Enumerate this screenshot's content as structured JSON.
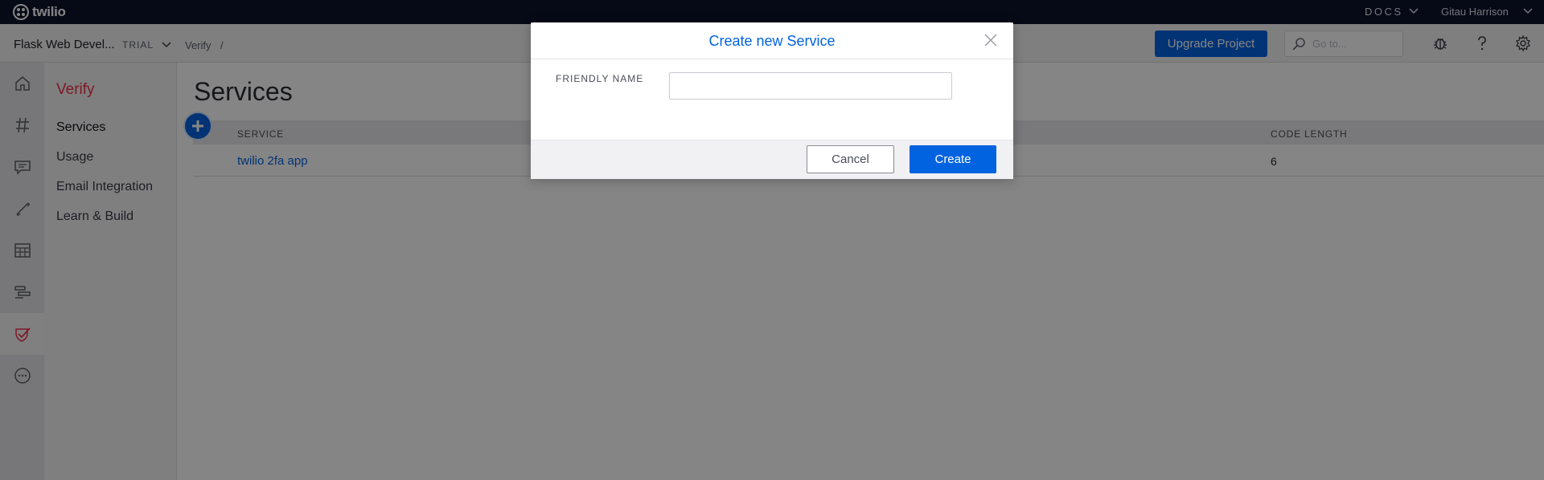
{
  "topbar": {
    "logo_text": "twilio",
    "docs_label": "DOCS",
    "user_name": "Gitau Harrison"
  },
  "subbar": {
    "project_name": "Flask Web Devel...",
    "project_badge": "TRIAL",
    "breadcrumb": "Verify",
    "breadcrumb_sep": "/",
    "upgrade_label": "Upgrade Project",
    "goto_placeholder": "Go to..."
  },
  "rail": {
    "items": [
      "home-icon",
      "hash-icon",
      "chat-icon",
      "phone-icon",
      "studio-icon",
      "flex-icon",
      "verify-icon",
      "more-icon"
    ],
    "active": "verify-icon"
  },
  "nav": {
    "title": "Verify",
    "items": [
      "Services",
      "Usage",
      "Email Integration",
      "Learn & Build"
    ],
    "active": "Services"
  },
  "main": {
    "title": "Services",
    "table": {
      "columns": [
        "SERVICE",
        "CODE LENGTH"
      ],
      "rows": [
        {
          "service": "twilio 2fa app",
          "code_length": "6"
        }
      ]
    }
  },
  "modal": {
    "title": "Create new Service",
    "field_label": "FRIENDLY NAME",
    "field_value": "",
    "cancel_label": "Cancel",
    "create_label": "Create"
  },
  "colors": {
    "brand_red": "#f22f46",
    "primary_blue": "#0263e0",
    "topbar_bg": "#0d122b"
  }
}
